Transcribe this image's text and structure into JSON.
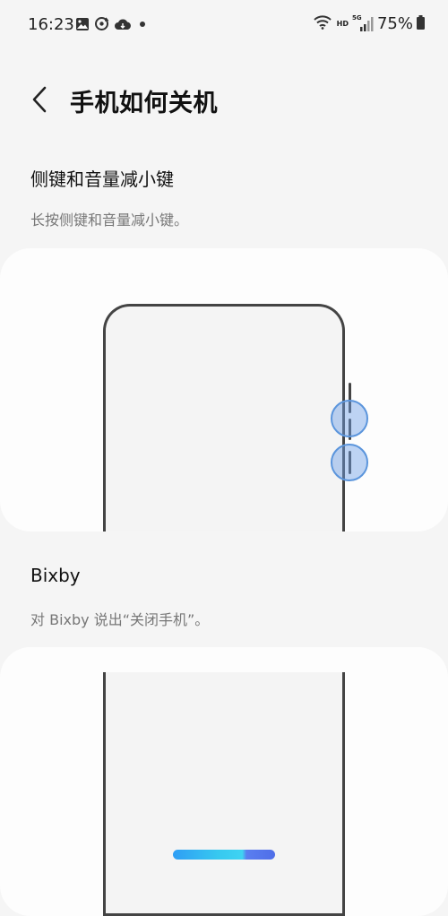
{
  "status_bar": {
    "time": "16:23",
    "battery": "75%",
    "network_labels": [
      "HD",
      "5G"
    ],
    "icons": [
      "gallery-icon",
      "sync-icon",
      "cloud-icon",
      "dot-icon",
      "wifi-icon",
      "signal-icon",
      "battery-icon"
    ]
  },
  "header": {
    "title": "手机如何关机"
  },
  "sections": [
    {
      "heading": "侧键和音量减小键",
      "description": "长按侧键和音量减小键。"
    },
    {
      "heading": "Bixby",
      "description": "对 Bixby 说出“关闭手机”。"
    }
  ],
  "colors": {
    "background": "#f5f5f5",
    "card": "#fdfdfd",
    "highlight": "#5b95dc",
    "bixby_gradient": [
      "#2f9ef4",
      "#3fd3f2",
      "#4f6ee8"
    ]
  }
}
